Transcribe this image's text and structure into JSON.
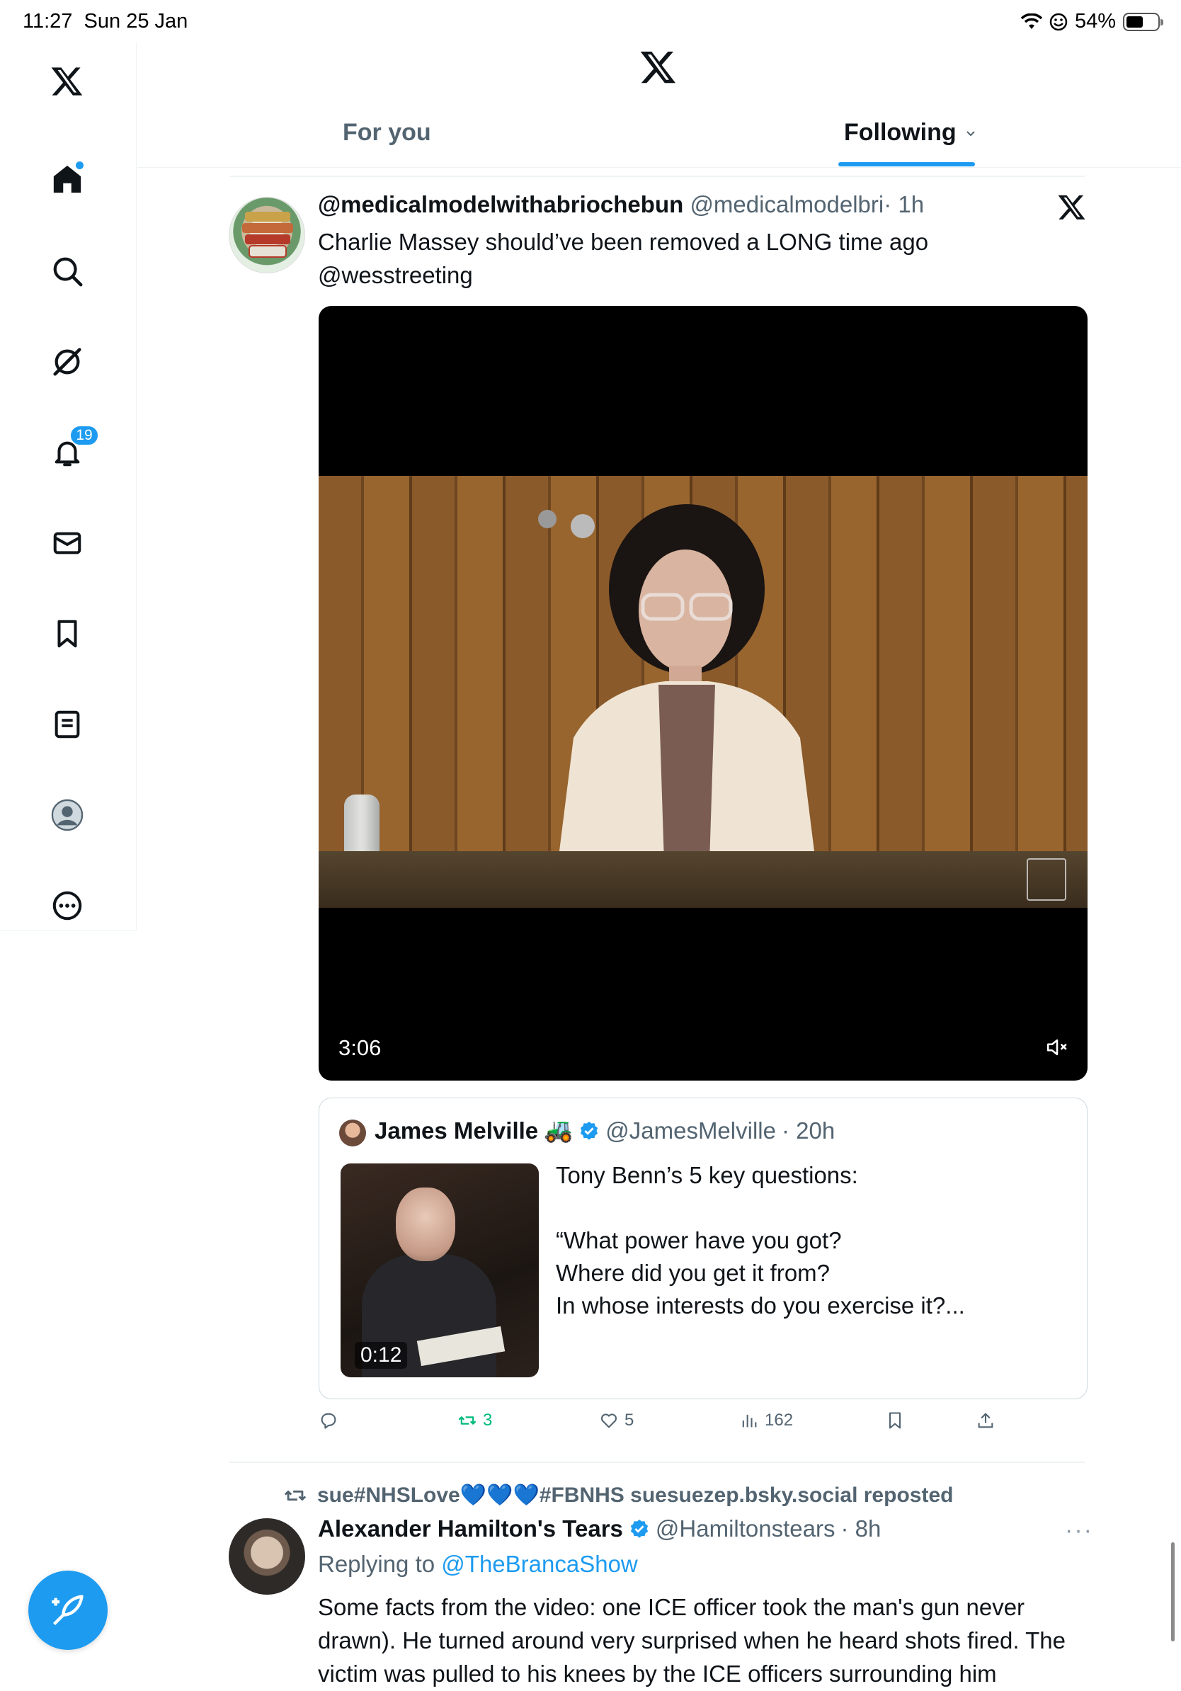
{
  "status_bar": {
    "time": "11:27",
    "date": "Sun 25 Jan",
    "battery": "54%"
  },
  "sidebar": {
    "items": [
      {
        "icon": "x-logo-icon"
      },
      {
        "icon": "home-icon"
      },
      {
        "icon": "search-icon"
      },
      {
        "icon": "grok-icon"
      },
      {
        "icon": "bell-icon",
        "badge": "19"
      },
      {
        "icon": "mail-icon"
      },
      {
        "icon": "bookmark-icon"
      },
      {
        "icon": "list-icon"
      },
      {
        "icon": "profile-icon"
      },
      {
        "icon": "more-icon"
      }
    ]
  },
  "header": {
    "tabs": [
      {
        "label": "For you",
        "active": false
      },
      {
        "label": "Following",
        "active": true
      }
    ]
  },
  "post1": {
    "display_name": "@medicalmodelwithabriochebun",
    "handle": "@medicalmodelbri",
    "time": "· 1h",
    "text_line1": "Charlie Massey should’ve been removed a LONG time ago",
    "text_line2": "@wesstreeting",
    "video_duration": "3:06",
    "quote": {
      "name": "James Melville",
      "emoji": "🚜",
      "handle": "@JamesMelville",
      "time": "· 20h",
      "thumb_duration": "0:12",
      "text": "Tony Benn’s 5 key questions:\n\n“What power have you got?\nWhere did you get it from?\nIn whose interests do you exercise it?..."
    },
    "actions": {
      "replies": "",
      "reposts": "3",
      "likes": "5",
      "views": "162"
    }
  },
  "post2": {
    "reposted_by": "sue#NHSLove💙💙💙#FBNHS suesuezep.bsky.social reposted",
    "display_name": "Alexander Hamilton's Tears",
    "handle": "@Hamiltonstears",
    "time": "· 8h",
    "replying_prefix": "Replying to",
    "replying_to": "@TheBrancaShow",
    "text": "Some facts from the video: one ICE officer took the man's gun never drawn). He turned around very surprised when he heard shots fired. The victim was pulled to his knees by the ICE officers surrounding him"
  },
  "colors": {
    "accent": "#1d9bf0",
    "muted": "#536471",
    "repost_green": "#00ba7c",
    "border": "#eff3f4"
  }
}
